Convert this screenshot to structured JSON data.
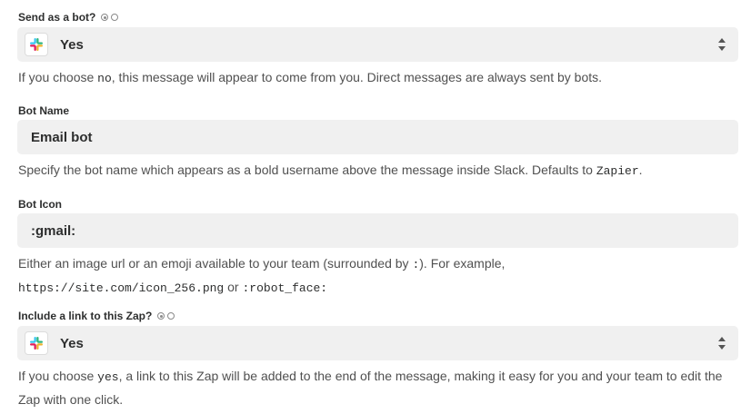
{
  "send_as_bot": {
    "label": "Send as a bot?",
    "value": "Yes",
    "help": {
      "p1": "If you choose ",
      "code1": "no",
      "p2": ", this message will appear to come from you. Direct messages are always sent by bots."
    }
  },
  "bot_name": {
    "label": "Bot Name",
    "value": "Email bot",
    "help": {
      "p1": "Specify the bot name which appears as a bold username above the message inside Slack. Defaults to ",
      "code1": "Zapier",
      "p2": "."
    }
  },
  "bot_icon": {
    "label": "Bot Icon",
    "value": ":gmail:",
    "help": {
      "p1": "Either an image url or an emoji available to your team (surrounded by ",
      "code1": ":",
      "p2": "). For example,",
      "code2": "https://site.com/icon_256.png",
      "p3": " or ",
      "code3": ":robot_face:"
    }
  },
  "include_link": {
    "label": "Include a link to this Zap?",
    "value": "Yes",
    "help": {
      "p1": "If you choose ",
      "code1": "yes",
      "p2": ", a link to this Zap will be added to the end of the message, making it easy for you and your team to edit the Zap with one click."
    }
  },
  "colors": {
    "field_bg": "#f0f0f0",
    "slack_blue": "#36c5f0",
    "slack_green": "#2eb67d",
    "slack_yellow": "#ecb22e",
    "slack_red": "#e01e5a"
  },
  "icons": [
    "radio-checked-icon",
    "radio-unchecked-icon",
    "slack-icon",
    "sort-arrows-icon"
  ]
}
